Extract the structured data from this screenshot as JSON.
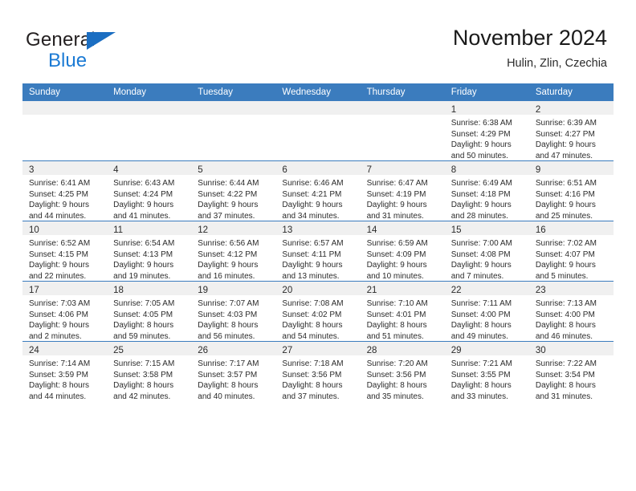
{
  "brand": {
    "name_part1": "General",
    "name_part2": "Blue",
    "accent_color": "#1b7ad4",
    "triangle_color": "#1b6ec2"
  },
  "header": {
    "title": "November 2024",
    "location": "Hulin, Zlin, Czechia"
  },
  "theme": {
    "header_row_bg": "#3b7cbe",
    "header_row_text": "#ffffff",
    "daynum_band_bg": "#f0f0f0",
    "cell_bg": "#ffffff",
    "grid_line": "#3b7cbe",
    "text_color": "#2b2b2b"
  },
  "weekday_headers": [
    "Sunday",
    "Monday",
    "Tuesday",
    "Wednesday",
    "Thursday",
    "Friday",
    "Saturday"
  ],
  "weeks": [
    [
      {
        "day": "",
        "lines": []
      },
      {
        "day": "",
        "lines": []
      },
      {
        "day": "",
        "lines": []
      },
      {
        "day": "",
        "lines": []
      },
      {
        "day": "",
        "lines": []
      },
      {
        "day": "1",
        "lines": [
          "Sunrise: 6:38 AM",
          "Sunset: 4:29 PM",
          "Daylight: 9 hours",
          "and 50 minutes."
        ]
      },
      {
        "day": "2",
        "lines": [
          "Sunrise: 6:39 AM",
          "Sunset: 4:27 PM",
          "Daylight: 9 hours",
          "and 47 minutes."
        ]
      }
    ],
    [
      {
        "day": "3",
        "lines": [
          "Sunrise: 6:41 AM",
          "Sunset: 4:25 PM",
          "Daylight: 9 hours",
          "and 44 minutes."
        ]
      },
      {
        "day": "4",
        "lines": [
          "Sunrise: 6:43 AM",
          "Sunset: 4:24 PM",
          "Daylight: 9 hours",
          "and 41 minutes."
        ]
      },
      {
        "day": "5",
        "lines": [
          "Sunrise: 6:44 AM",
          "Sunset: 4:22 PM",
          "Daylight: 9 hours",
          "and 37 minutes."
        ]
      },
      {
        "day": "6",
        "lines": [
          "Sunrise: 6:46 AM",
          "Sunset: 4:21 PM",
          "Daylight: 9 hours",
          "and 34 minutes."
        ]
      },
      {
        "day": "7",
        "lines": [
          "Sunrise: 6:47 AM",
          "Sunset: 4:19 PM",
          "Daylight: 9 hours",
          "and 31 minutes."
        ]
      },
      {
        "day": "8",
        "lines": [
          "Sunrise: 6:49 AM",
          "Sunset: 4:18 PM",
          "Daylight: 9 hours",
          "and 28 minutes."
        ]
      },
      {
        "day": "9",
        "lines": [
          "Sunrise: 6:51 AM",
          "Sunset: 4:16 PM",
          "Daylight: 9 hours",
          "and 25 minutes."
        ]
      }
    ],
    [
      {
        "day": "10",
        "lines": [
          "Sunrise: 6:52 AM",
          "Sunset: 4:15 PM",
          "Daylight: 9 hours",
          "and 22 minutes."
        ]
      },
      {
        "day": "11",
        "lines": [
          "Sunrise: 6:54 AM",
          "Sunset: 4:13 PM",
          "Daylight: 9 hours",
          "and 19 minutes."
        ]
      },
      {
        "day": "12",
        "lines": [
          "Sunrise: 6:56 AM",
          "Sunset: 4:12 PM",
          "Daylight: 9 hours",
          "and 16 minutes."
        ]
      },
      {
        "day": "13",
        "lines": [
          "Sunrise: 6:57 AM",
          "Sunset: 4:11 PM",
          "Daylight: 9 hours",
          "and 13 minutes."
        ]
      },
      {
        "day": "14",
        "lines": [
          "Sunrise: 6:59 AM",
          "Sunset: 4:09 PM",
          "Daylight: 9 hours",
          "and 10 minutes."
        ]
      },
      {
        "day": "15",
        "lines": [
          "Sunrise: 7:00 AM",
          "Sunset: 4:08 PM",
          "Daylight: 9 hours",
          "and 7 minutes."
        ]
      },
      {
        "day": "16",
        "lines": [
          "Sunrise: 7:02 AM",
          "Sunset: 4:07 PM",
          "Daylight: 9 hours",
          "and 5 minutes."
        ]
      }
    ],
    [
      {
        "day": "17",
        "lines": [
          "Sunrise: 7:03 AM",
          "Sunset: 4:06 PM",
          "Daylight: 9 hours",
          "and 2 minutes."
        ]
      },
      {
        "day": "18",
        "lines": [
          "Sunrise: 7:05 AM",
          "Sunset: 4:05 PM",
          "Daylight: 8 hours",
          "and 59 minutes."
        ]
      },
      {
        "day": "19",
        "lines": [
          "Sunrise: 7:07 AM",
          "Sunset: 4:03 PM",
          "Daylight: 8 hours",
          "and 56 minutes."
        ]
      },
      {
        "day": "20",
        "lines": [
          "Sunrise: 7:08 AM",
          "Sunset: 4:02 PM",
          "Daylight: 8 hours",
          "and 54 minutes."
        ]
      },
      {
        "day": "21",
        "lines": [
          "Sunrise: 7:10 AM",
          "Sunset: 4:01 PM",
          "Daylight: 8 hours",
          "and 51 minutes."
        ]
      },
      {
        "day": "22",
        "lines": [
          "Sunrise: 7:11 AM",
          "Sunset: 4:00 PM",
          "Daylight: 8 hours",
          "and 49 minutes."
        ]
      },
      {
        "day": "23",
        "lines": [
          "Sunrise: 7:13 AM",
          "Sunset: 4:00 PM",
          "Daylight: 8 hours",
          "and 46 minutes."
        ]
      }
    ],
    [
      {
        "day": "24",
        "lines": [
          "Sunrise: 7:14 AM",
          "Sunset: 3:59 PM",
          "Daylight: 8 hours",
          "and 44 minutes."
        ]
      },
      {
        "day": "25",
        "lines": [
          "Sunrise: 7:15 AM",
          "Sunset: 3:58 PM",
          "Daylight: 8 hours",
          "and 42 minutes."
        ]
      },
      {
        "day": "26",
        "lines": [
          "Sunrise: 7:17 AM",
          "Sunset: 3:57 PM",
          "Daylight: 8 hours",
          "and 40 minutes."
        ]
      },
      {
        "day": "27",
        "lines": [
          "Sunrise: 7:18 AM",
          "Sunset: 3:56 PM",
          "Daylight: 8 hours",
          "and 37 minutes."
        ]
      },
      {
        "day": "28",
        "lines": [
          "Sunrise: 7:20 AM",
          "Sunset: 3:56 PM",
          "Daylight: 8 hours",
          "and 35 minutes."
        ]
      },
      {
        "day": "29",
        "lines": [
          "Sunrise: 7:21 AM",
          "Sunset: 3:55 PM",
          "Daylight: 8 hours",
          "and 33 minutes."
        ]
      },
      {
        "day": "30",
        "lines": [
          "Sunrise: 7:22 AM",
          "Sunset: 3:54 PM",
          "Daylight: 8 hours",
          "and 31 minutes."
        ]
      }
    ]
  ]
}
